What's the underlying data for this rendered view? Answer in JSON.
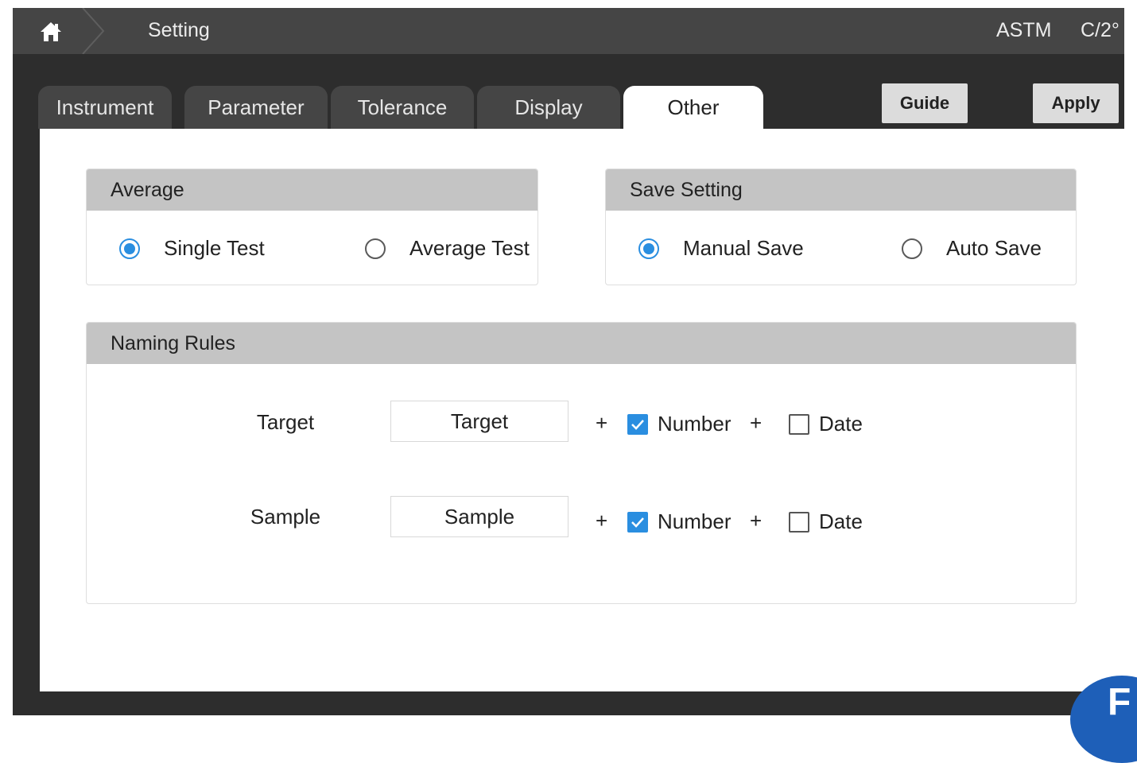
{
  "header": {
    "title": "Setting",
    "standard": "ASTM",
    "observer": "C/2°"
  },
  "tabs": [
    {
      "label": "Instrument",
      "active": false
    },
    {
      "label": "Parameter",
      "active": false
    },
    {
      "label": "Tolerance",
      "active": false
    },
    {
      "label": "Display",
      "active": false
    },
    {
      "label": "Other",
      "active": true
    }
  ],
  "actions": {
    "guide_label": "Guide",
    "apply_label": "Apply"
  },
  "average": {
    "title": "Average",
    "options": [
      {
        "label": "Single Test",
        "selected": true
      },
      {
        "label": "Average Test",
        "selected": false
      }
    ]
  },
  "save_setting": {
    "title": "Save Setting",
    "options": [
      {
        "label": "Manual Save",
        "selected": true
      },
      {
        "label": "Auto Save",
        "selected": false
      }
    ]
  },
  "naming_rules": {
    "title": "Naming Rules",
    "rows": [
      {
        "label": "Target",
        "value": "Target",
        "number_label": "Number",
        "number_checked": true,
        "date_label": "Date",
        "date_checked": false
      },
      {
        "label": "Sample",
        "value": "Sample",
        "number_label": "Number",
        "number_checked": true,
        "date_label": "Date",
        "date_checked": false
      }
    ],
    "plus": "+"
  },
  "colors": {
    "accent": "#2a8ee0",
    "bar": "#454545",
    "section_header": "#c4c4c4"
  },
  "icons": {
    "home": "home-icon",
    "check": "checkmark-icon"
  }
}
